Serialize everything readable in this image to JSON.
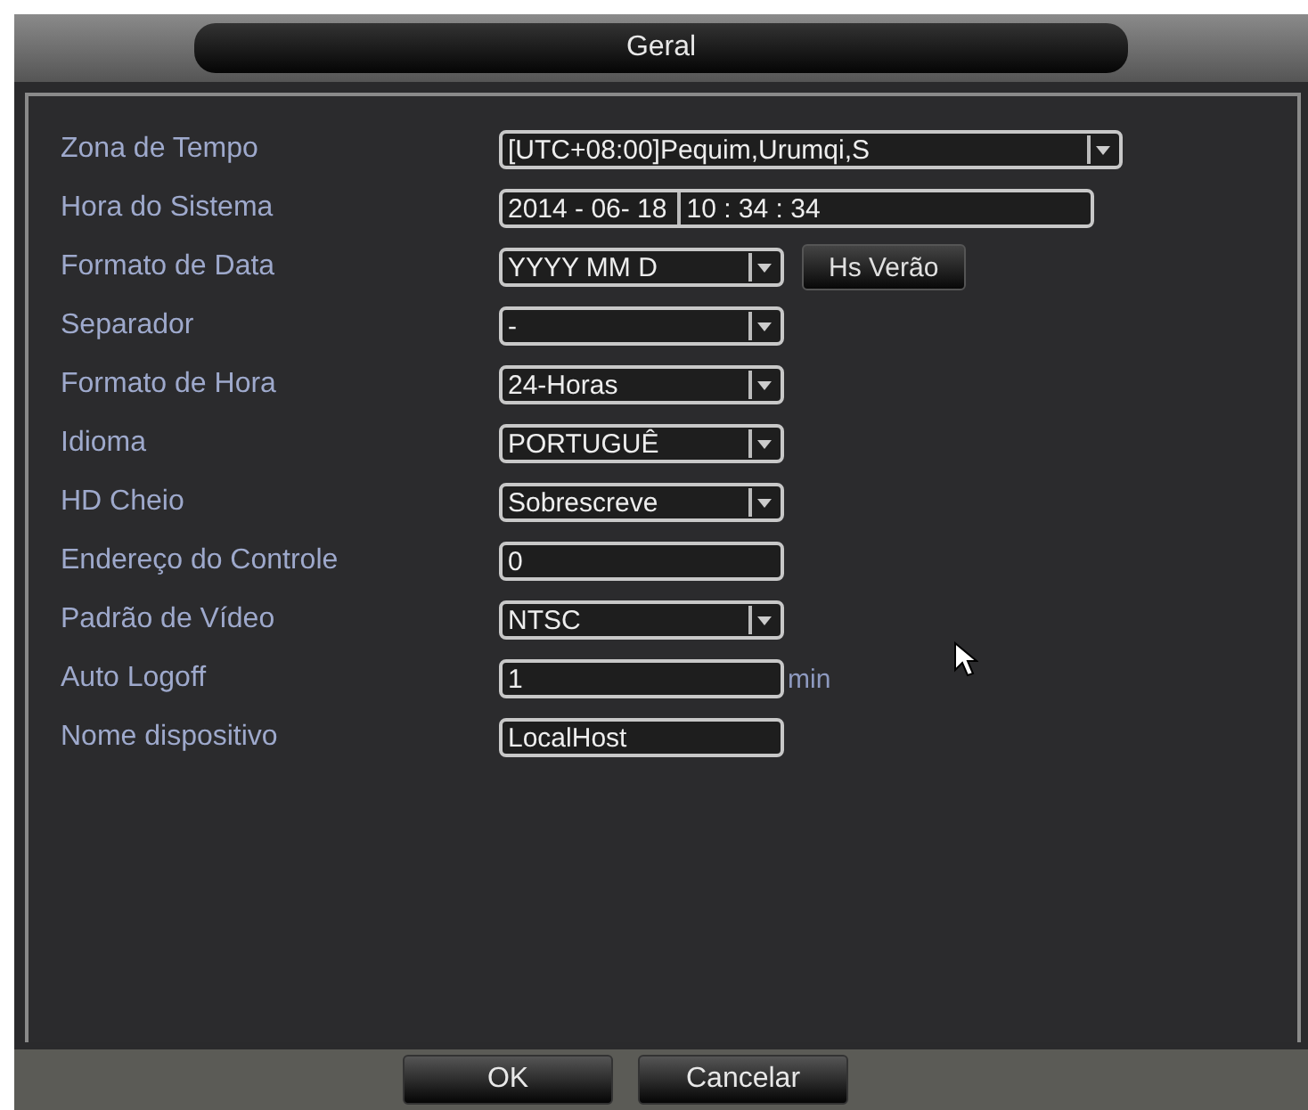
{
  "window": {
    "title": "Geral"
  },
  "settings": [
    {
      "kind": "wide_dropdown",
      "label": "Zona de Tempo",
      "value": "[UTC+08:00]Pequim,Urumqi,S"
    },
    {
      "kind": "datetime",
      "label": "Hora do Sistema",
      "date": "2014 - 06- 18",
      "time": "10 : 34 : 34"
    },
    {
      "kind": "dropdown",
      "label": "Formato de Data",
      "value": "YYYY MM D",
      "button": "Hs Verão"
    },
    {
      "kind": "dropdown",
      "label": "Separador",
      "value": "-"
    },
    {
      "kind": "dropdown",
      "label": "Formato de Hora",
      "value": "24-Horas"
    },
    {
      "kind": "dropdown",
      "label": "Idioma",
      "value": "PORTUGUÊ"
    },
    {
      "kind": "dropdown",
      "label": "HD Cheio",
      "value": "Sobrescreve"
    },
    {
      "kind": "text",
      "label": "Endereço do Controle",
      "value": "0"
    },
    {
      "kind": "dropdown",
      "label": "Padrão de Vídeo",
      "value": "NTSC"
    },
    {
      "kind": "text",
      "label": "Auto Logoff",
      "value": "1",
      "suffix": "min"
    },
    {
      "kind": "text",
      "label": "Nome dispositivo",
      "value": "LocalHost"
    }
  ],
  "buttons": [
    "OK",
    "Cancelar"
  ]
}
